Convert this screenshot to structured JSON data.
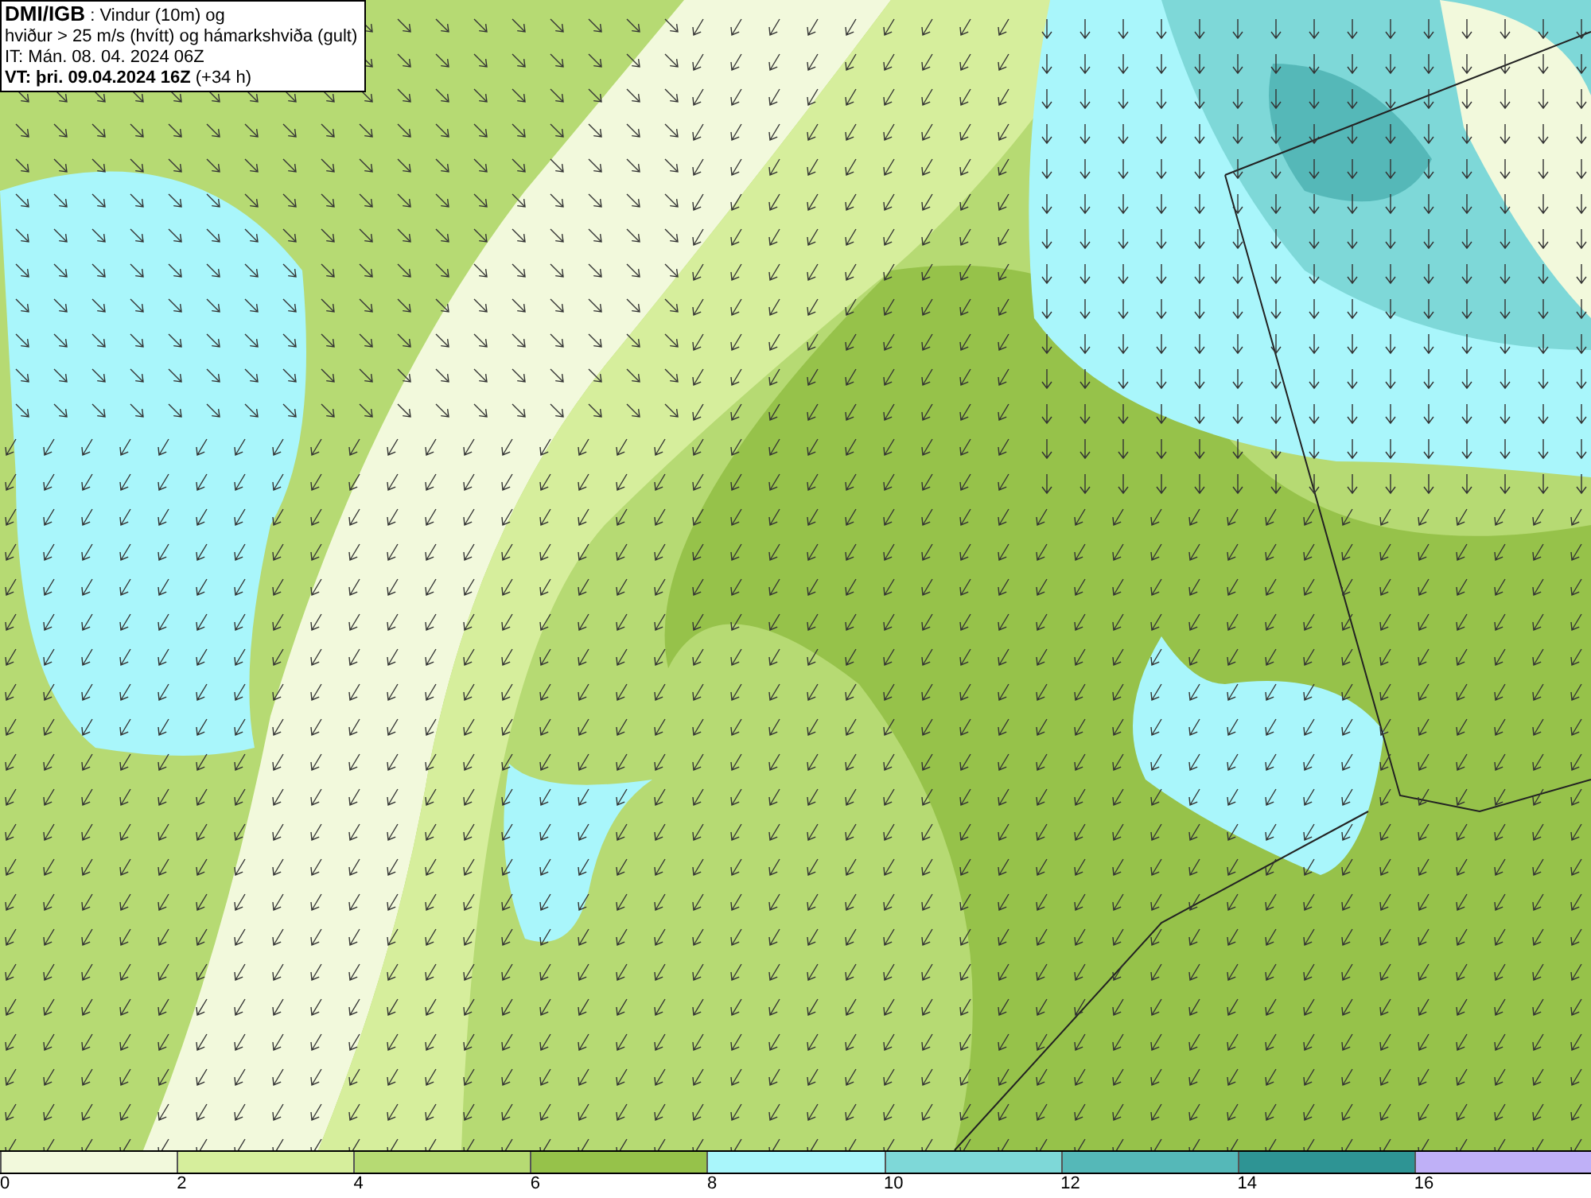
{
  "header": {
    "title": "DMI/IGB",
    "title_rest": " : Vindur (10m) og",
    "line2": "hviður > 25 m/s (hvítt) og hámarkshviða (gult)",
    "issue": "IT: Mán. 08. 04. 2024 06Z",
    "valid": "VT: þri. 09.04.2024 16Z",
    "lead": "(+34 h)"
  },
  "legend": {
    "bins": [
      {
        "color": "#f2f9dc"
      },
      {
        "color": "#d6ee9c"
      },
      {
        "color": "#b6da73"
      },
      {
        "color": "#96c24a"
      },
      {
        "color": "#a9f6fb"
      },
      {
        "color": "#7ed8d8"
      },
      {
        "color": "#55b8b8"
      },
      {
        "color": "#2e9494"
      },
      {
        "color": "#bfb0f7"
      }
    ],
    "ticks": [
      "0",
      "2",
      "4",
      "6",
      "8",
      "10",
      "12",
      "14",
      "16"
    ]
  }
}
